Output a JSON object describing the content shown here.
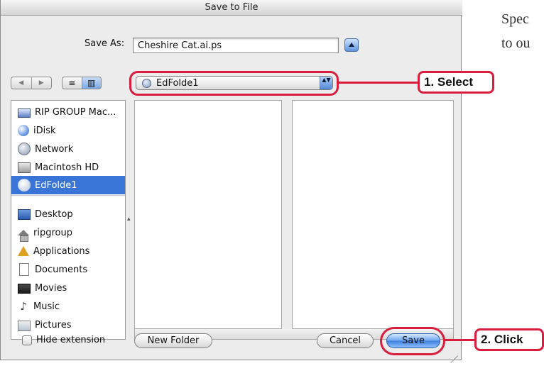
{
  "window": {
    "title": "Save to File"
  },
  "save_as": {
    "label": "Save As:",
    "value": "Cheshire Cat.ai.ps"
  },
  "toolbar": {
    "back_glyph": "◀",
    "forward_glyph": "▶",
    "list_view_glyph": "≡",
    "column_view_glyph": "▥"
  },
  "location": {
    "value": "EdFolde1",
    "arrow": "▲▼"
  },
  "sidebar": {
    "items": [
      {
        "label": "RIP GROUP Mac...",
        "icon": "computer-icon"
      },
      {
        "label": "iDisk",
        "icon": "idisk-icon"
      },
      {
        "label": "Network",
        "icon": "network-icon"
      },
      {
        "label": "Macintosh HD",
        "icon": "hard-disk-icon"
      },
      {
        "label": "EdFolde1",
        "icon": "network-volume-icon",
        "selected": true
      },
      {
        "label": "Desktop",
        "icon": "desktop-icon"
      },
      {
        "label": "ripgroup",
        "icon": "home-icon"
      },
      {
        "label": "Applications",
        "icon": "applications-icon"
      },
      {
        "label": "Documents",
        "icon": "documents-icon"
      },
      {
        "label": "Movies",
        "icon": "movies-icon"
      },
      {
        "label": "Music",
        "icon": "music-icon"
      },
      {
        "label": "Pictures",
        "icon": "pictures-icon"
      }
    ]
  },
  "footer": {
    "hide_extension_label": "Hide extension",
    "hide_extension_checked": false,
    "new_folder_label": "New Folder",
    "cancel_label": "Cancel",
    "save_label": "Save"
  },
  "callouts": {
    "select": "1. Select",
    "click": "2. Click"
  },
  "side_text": {
    "line1": "Spec",
    "line2": "to ou"
  },
  "colors": {
    "accent": "#d81e3c",
    "selection": "#3875d7",
    "dialog_bg": "#ececec"
  }
}
